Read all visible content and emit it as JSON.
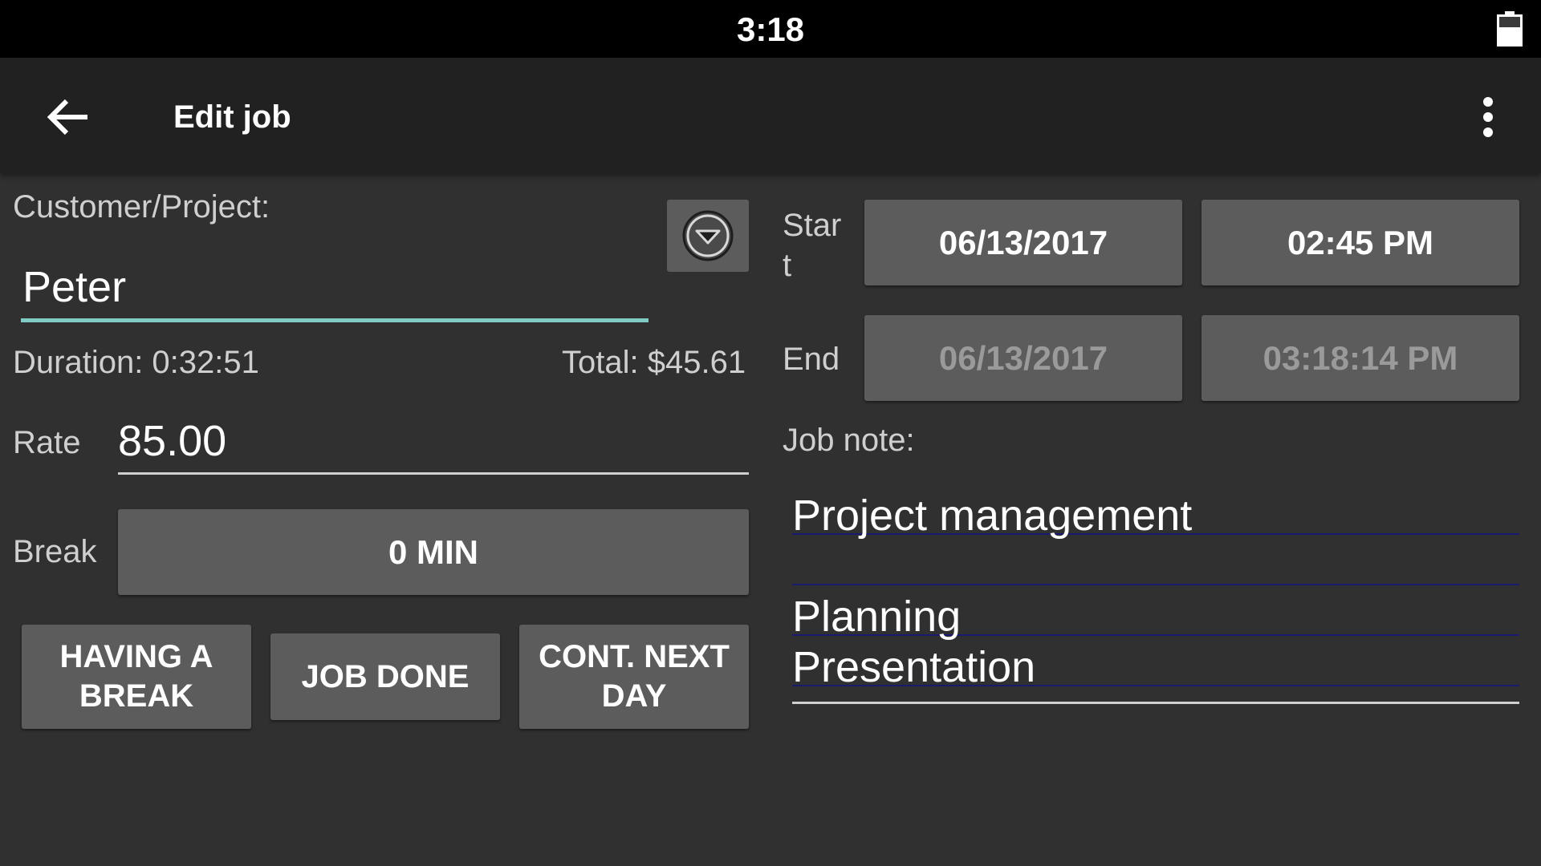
{
  "status_bar": {
    "time": "3:18",
    "battery_icon": "battery-icon",
    "battery_level": 0.62
  },
  "toolbar": {
    "title": "Edit job",
    "back_icon": "arrow-left-icon",
    "overflow_icon": "more-vertical-icon"
  },
  "form": {
    "customer_label": "Customer/Project:",
    "customer_value": "Peter",
    "customer_dropdown_icon": "chevron-down-circle-icon",
    "duration_text": "Duration: 0:32:51",
    "total_text": "Total: $45.61",
    "rate_label": "Rate",
    "rate_value": "85.00",
    "break_label": "Break",
    "break_value": "0 MIN"
  },
  "actions": {
    "having_break": "HAVING A BREAK",
    "job_done": "JOB DONE",
    "cont_next_day": "CONT. NEXT DAY"
  },
  "schedule": {
    "start_label_line1": "Star",
    "start_label_line2": "t",
    "start_date": "06/13/2017",
    "start_time": "02:45 PM",
    "end_label": "End",
    "end_date": "06/13/2017",
    "end_time": "03:18:14 PM"
  },
  "note": {
    "label": "Job note:",
    "text": "Project management\n\nPlanning\nPresentation"
  },
  "colors": {
    "background": "#303030",
    "toolbar": "#212121",
    "status_bar": "#000000",
    "button": "#5c5c5c",
    "accent_underline": "#80cbc4",
    "note_lines": "#1a1a6e"
  }
}
